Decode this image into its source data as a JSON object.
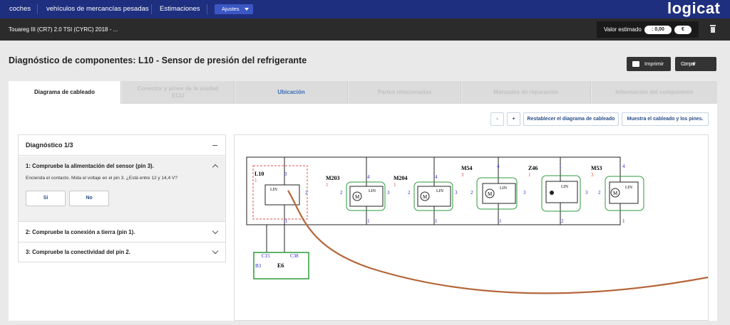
{
  "topnav": {
    "items": [
      "coches",
      "vehículos de mercancías pesadas",
      "Estimaciones"
    ],
    "ajustes_label": "Ajustes",
    "logo": "logicat"
  },
  "vehicle_bar": {
    "vehicle": "Touareg III (CR7) 2.0 TSI (CYRC) 2018 - ...",
    "valor_label": "Valor estimado",
    "valor_value": ": 0,00",
    "currency": "€"
  },
  "header": {
    "title": "Diagnóstico de componentes: L10 - Sensor de presión del refrigerante",
    "print_label": "Imprimir",
    "share_label": "Compartir"
  },
  "tabs": [
    "Diagrama de cableado",
    "Conector y pines de la unidad ECU",
    "Ubicación",
    "Partes relacionadas",
    "Manuales de reparación",
    "Información del componente"
  ],
  "toolbar": {
    "minus": "-",
    "plus": "+",
    "reset": "Restablecer el diagrama de cableado",
    "show": "Muestra el cableado y los pines."
  },
  "diagnostic": {
    "title": "Diagnóstico 1/3",
    "steps": [
      {
        "title": "1: Compruebe la alimentación del sensor (pin 3).",
        "description": "Encienda el contacto. Mida el voltaje en el pin 3. ¿Está entre 12 y 14,4 V?",
        "yes": "Sí",
        "no": "No"
      },
      {
        "title": "2: Compruebe la conexión a tierra (pin 1)."
      },
      {
        "title": "3: Compruebe la conectividad del pin 2."
      }
    ]
  },
  "wiring": {
    "components": [
      {
        "name": "L10",
        "num": "1",
        "pins": [
          "3",
          "2",
          "1"
        ]
      },
      {
        "name": "M203",
        "num": "1",
        "pins": [
          "4",
          "2",
          "3",
          "1"
        ]
      },
      {
        "name": "M204",
        "num": "1",
        "pins": [
          "4",
          "2",
          "3",
          "1"
        ]
      },
      {
        "name": "M54",
        "num": "3",
        "pins": [
          "4",
          "2",
          "3",
          "1"
        ]
      },
      {
        "name": "Z46",
        "num": "1",
        "pins": [
          "1",
          "3",
          "2"
        ]
      },
      {
        "name": "M53",
        "num": "3",
        "pins": [
          "4",
          "2",
          "1"
        ]
      }
    ],
    "lin_label": "LIN",
    "motor_label": "M",
    "ecu": {
      "name": "E6",
      "pins": [
        "C15",
        "C38",
        "B3"
      ]
    },
    "colors": {
      "line": "#222222",
      "green": "#2f9a3a",
      "highlight": "#e05050",
      "pin": "#2a2ad0",
      "wire": "#b5673a"
    }
  }
}
